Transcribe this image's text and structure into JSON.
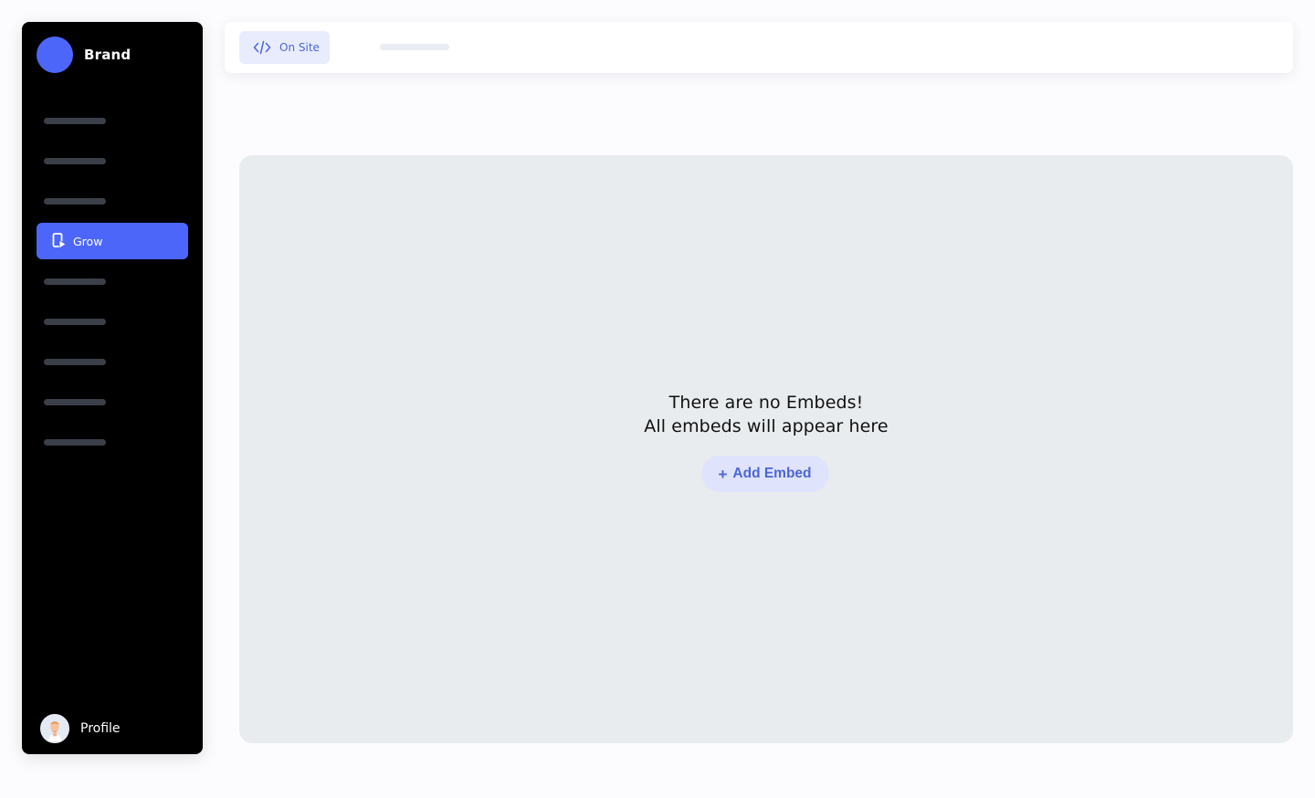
{
  "brand": {
    "name": "Brand",
    "logo_color": "#4d66fa"
  },
  "sidebar": {
    "active_item": {
      "label": "Grow",
      "icon": "grow-icon"
    },
    "profile": {
      "name": "Profile",
      "icon": "avatar"
    }
  },
  "topbar": {
    "tabs": [
      {
        "label": "On Site",
        "icon": "code-icon",
        "selected": true
      }
    ]
  },
  "empty_state": {
    "title": "There are no Embeds!",
    "subtitle": "All embeds will appear here",
    "button_label": "Add Embed",
    "button_icon": "plus-icon"
  },
  "colors": {
    "accent": "#4d66fa",
    "sidebar_bg": "#000000",
    "panel_bg": "#e9ecee"
  }
}
